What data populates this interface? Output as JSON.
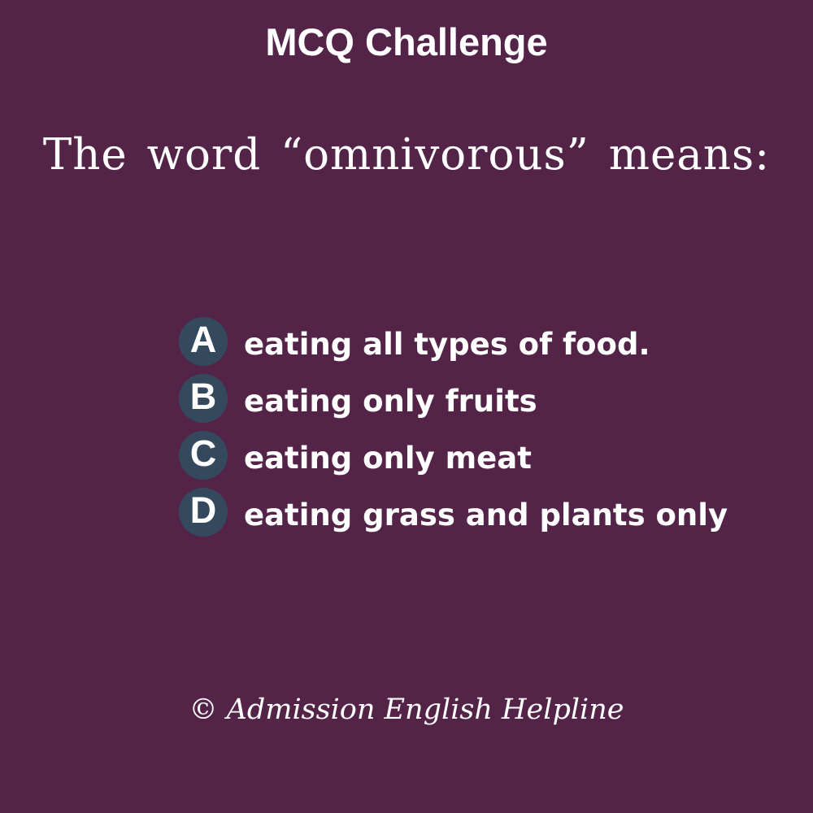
{
  "title": "MCQ Challenge",
  "question": "The word “omnivorous” means:",
  "options": [
    {
      "letter": "A",
      "text": "eating all types of food."
    },
    {
      "letter": "B",
      "text": "eating only fruits"
    },
    {
      "letter": "C",
      "text": "eating only meat"
    },
    {
      "letter": "D",
      "text": "eating grass and plants only"
    }
  ],
  "footer": "© Admission English Helpline",
  "colors": {
    "background": "#532448",
    "badge": "#34495e",
    "text": "#ffffff"
  }
}
